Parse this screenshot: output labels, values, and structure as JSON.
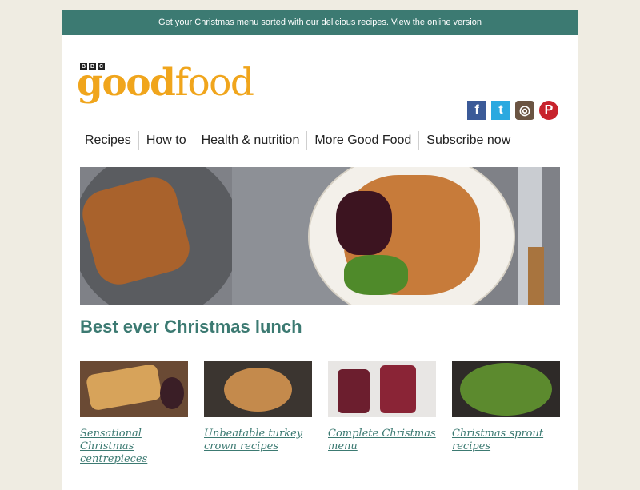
{
  "topbar": {
    "text": "Get your Christmas menu sorted with our delicious recipes.",
    "link": "View the online version"
  },
  "logo": {
    "bbc": [
      "B",
      "B",
      "C"
    ],
    "good": "good",
    "food": "food"
  },
  "social": [
    {
      "name": "facebook-icon",
      "glyph": "f"
    },
    {
      "name": "twitter-icon",
      "glyph": "t"
    },
    {
      "name": "instagram-icon",
      "glyph": "◎"
    },
    {
      "name": "pinterest-icon",
      "glyph": "P"
    }
  ],
  "nav": [
    "Recipes",
    "How to",
    "Health & nutrition",
    "More Good Food",
    "Subscribe now"
  ],
  "hero_icon": "christmas-dinner-photo",
  "headline": "Best ever Christmas lunch",
  "cards": [
    {
      "label": "Sensational Christmas centrepieces",
      "icon": "centrepiece-photo"
    },
    {
      "label": "Unbeatable turkey crown recipes",
      "icon": "turkey-photo"
    },
    {
      "label": "Complete Christmas menu",
      "icon": "trifle-photo"
    },
    {
      "label": "Christmas sprout recipes",
      "icon": "sprouts-photo"
    }
  ],
  "colors": {
    "teal": "#3c7a72",
    "orange": "#f0a51c",
    "background": "#efece2"
  }
}
